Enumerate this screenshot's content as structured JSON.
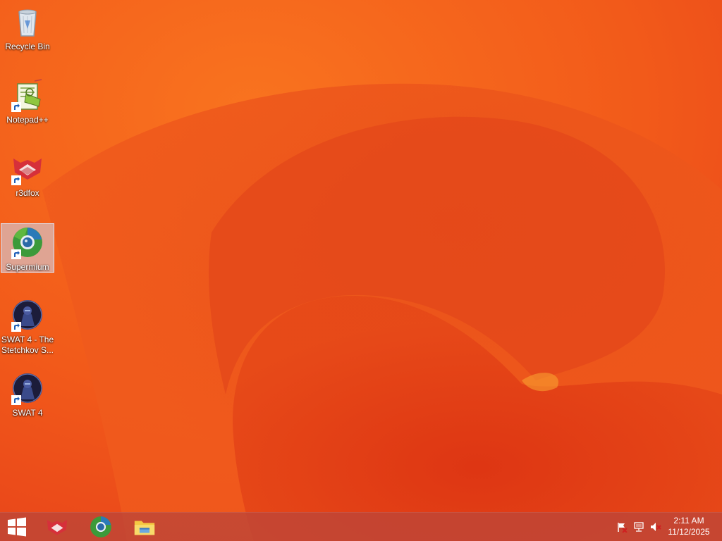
{
  "desktop": {
    "icons": [
      {
        "label": "Recycle Bin",
        "icon": "recycle-bin-icon"
      },
      {
        "label": "Notepad++",
        "icon": "notepad-plus-plus-icon"
      },
      {
        "label": "r3dfox",
        "icon": "r3dfox-icon"
      },
      {
        "label": "Supermium",
        "icon": "supermium-icon"
      },
      {
        "label": "SWAT 4 - The Stetchkov S...",
        "icon": "swat4-icon"
      },
      {
        "label": "SWAT 4",
        "icon": "swat4-icon"
      }
    ],
    "selected_icon": "Supermium"
  },
  "taskbar": {
    "start": "windows-start-icon",
    "pinned": [
      "r3dfox-icon",
      "supermium-icon",
      "file-explorer-icon"
    ],
    "tray_icons": [
      "action-center-flag-icon",
      "network-icon",
      "volume-muted-icon"
    ],
    "clock": {
      "time": "2:11 AM",
      "date": "11/12/2025"
    }
  },
  "colors": {
    "wallpaper": "#f0541a",
    "taskbar": "#be4637"
  }
}
